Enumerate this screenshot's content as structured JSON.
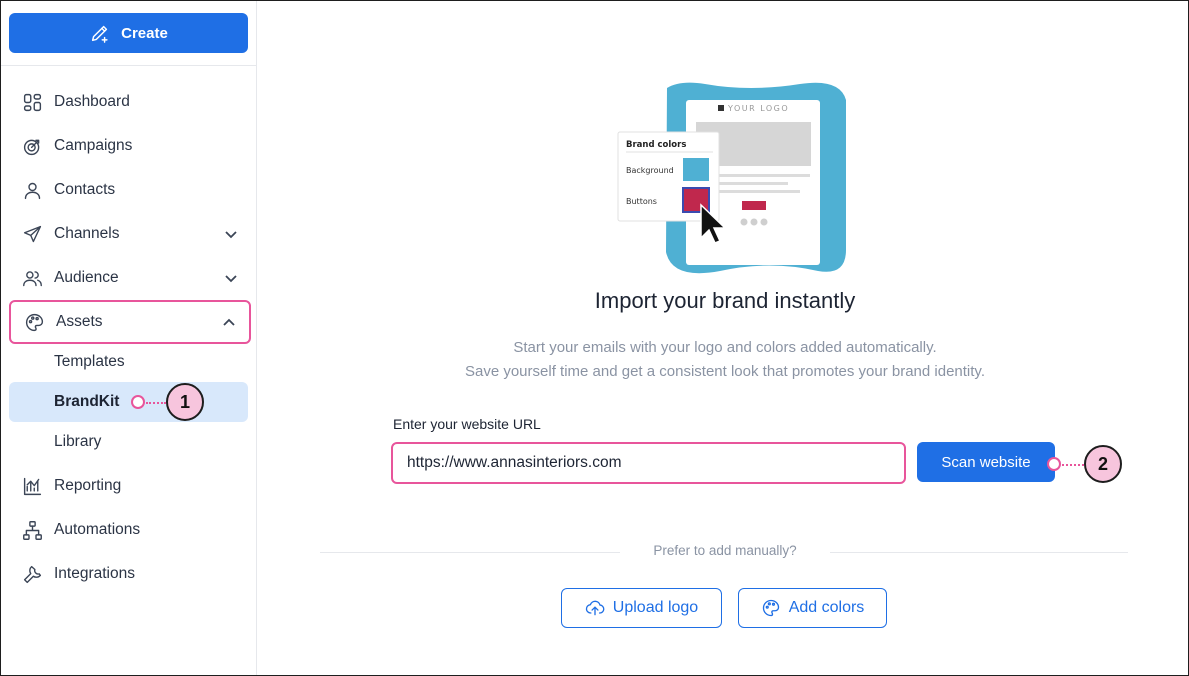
{
  "sidebar": {
    "create_label": "Create",
    "items": [
      {
        "label": "Dashboard",
        "icon": "dashboard-icon"
      },
      {
        "label": "Campaigns",
        "icon": "target-icon"
      },
      {
        "label": "Contacts",
        "icon": "person-icon"
      },
      {
        "label": "Channels",
        "icon": "paper-plane-icon"
      },
      {
        "label": "Audience",
        "icon": "people-icon"
      },
      {
        "label": "Assets",
        "icon": "palette-icon"
      },
      {
        "label": "Reporting",
        "icon": "chart-icon"
      },
      {
        "label": "Automations",
        "icon": "flow-icon"
      },
      {
        "label": "Integrations",
        "icon": "wrench-icon"
      }
    ],
    "asset_subitems": [
      "Templates",
      "BrandKit",
      "Library"
    ]
  },
  "illustration": {
    "logo_text": "YOUR LOGO",
    "popup_title": "Brand colors",
    "background_label": "Background",
    "buttons_label": "Buttons",
    "background_color": "#4fb0d3",
    "button_color": "#c0284d"
  },
  "main": {
    "heading": "Import your brand instantly",
    "desc_line1": "Start your emails with your logo and colors added automatically.",
    "desc_line2": "Save yourself time and get a consistent look that promotes your brand identity.",
    "url_label": "Enter your website URL",
    "url_value": "https://www.annasinteriors.com",
    "scan_label": "Scan website",
    "manual_prompt": "Prefer to add manually?",
    "upload_label": "Upload logo",
    "colors_label": "Add colors"
  },
  "callouts": {
    "one": "1",
    "two": "2"
  },
  "colors": {
    "accent": "#1f6fe5",
    "highlight": "#e8559b",
    "active_bg": "#d8e8fb"
  }
}
